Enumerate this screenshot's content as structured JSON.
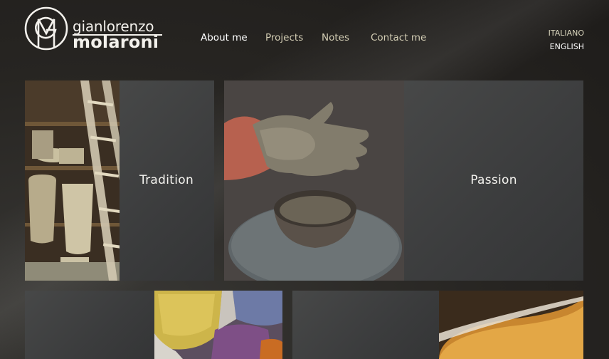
{
  "brand": {
    "monogram": "GM",
    "first_name": "gianlorenzo",
    "last_name": "molaroni"
  },
  "nav": {
    "items": [
      {
        "label": "About me",
        "active": true
      },
      {
        "label": "Projects",
        "active": false
      },
      {
        "label": "Notes",
        "active": false
      },
      {
        "label": "Contact me",
        "active": false
      }
    ]
  },
  "languages": {
    "items": [
      {
        "label": "ITALIANO",
        "active": false
      },
      {
        "label": "ENGLISH",
        "active": true
      }
    ]
  },
  "tiles": [
    {
      "label": "Tradition",
      "image": "shelves-of-clay-pots-photo"
    },
    {
      "label": "Passion",
      "image": "clay-covered-hand-photo"
    },
    {
      "label": "",
      "image": "pigment-bags-photo"
    },
    {
      "label": "",
      "image": "amber-glaze-bowl-photo"
    }
  ],
  "colors": {
    "background": "#272522",
    "panel": "#444546",
    "nav_text": "#d3cdb4",
    "nav_active": "#ffffff"
  }
}
